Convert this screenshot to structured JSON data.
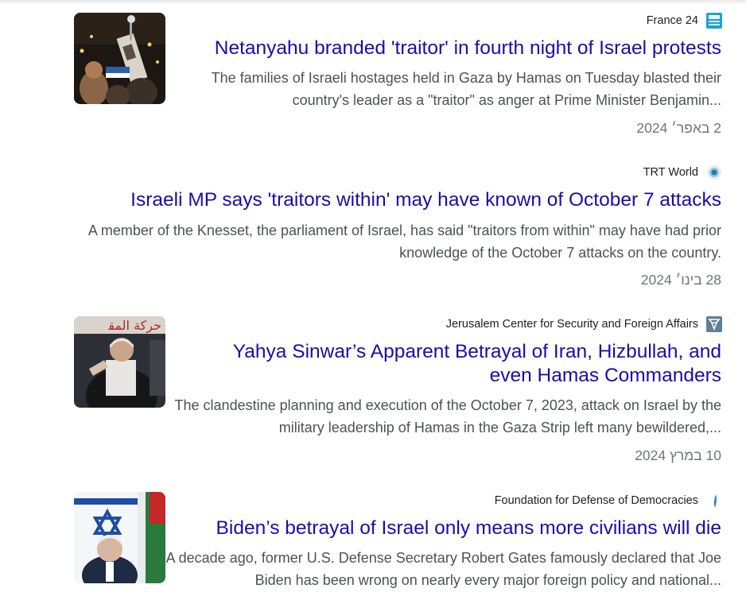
{
  "results": [
    {
      "source": "France 24",
      "source_icon": "france24-logo-icon",
      "headline": "Netanyahu branded 'traitor' in fourth night of Israel protests",
      "snippet_line1": "The families of Israeli hostages held in Gaza by Hamas on Tuesday blasted their",
      "snippet_line2": "country's leader as a \"traitor\" as anger at Prime Minister Benjamin...",
      "date": "2 באפר׳ 2024"
    },
    {
      "source": "TRT World",
      "source_icon": "trt-world-logo-icon",
      "headline": "Israeli MP says 'traitors within' may have known of October 7 attacks",
      "snippet_line1": "A member of the Knesset, the parliament of Israel, has said \"traitors from within\" may have had prior",
      "snippet_line2": "knowledge of the October 7 attacks on the country.",
      "date": "28 בינו׳ 2024"
    },
    {
      "source": "Jerusalem Center for Security and Foreign Affairs",
      "source_icon": "jcpa-logo-icon",
      "headline_line1": "Yahya Sinwar’s Apparent Betrayal of Iran, Hizbullah, and",
      "headline_line2": "even Hamas Commanders",
      "snippet_line1": "The clandestine planning and execution of the October 7, 2023, attack on Israel by the",
      "snippet_line2": "military leadership of Hamas in the Gaza Strip left many bewildered,...",
      "date": "10 במרץ 2024"
    },
    {
      "source": "Foundation for Defense of Democracies",
      "source_icon": "fdd-logo-icon",
      "headline": "Biden’s betrayal of Israel only means more civilians will die",
      "snippet_line1": "A decade ago, former U.S. Defense Secretary Robert Gates famously declared that Joe",
      "snippet_line2": "Biden has been wrong on nearly every major foreign policy and national..."
    }
  ]
}
